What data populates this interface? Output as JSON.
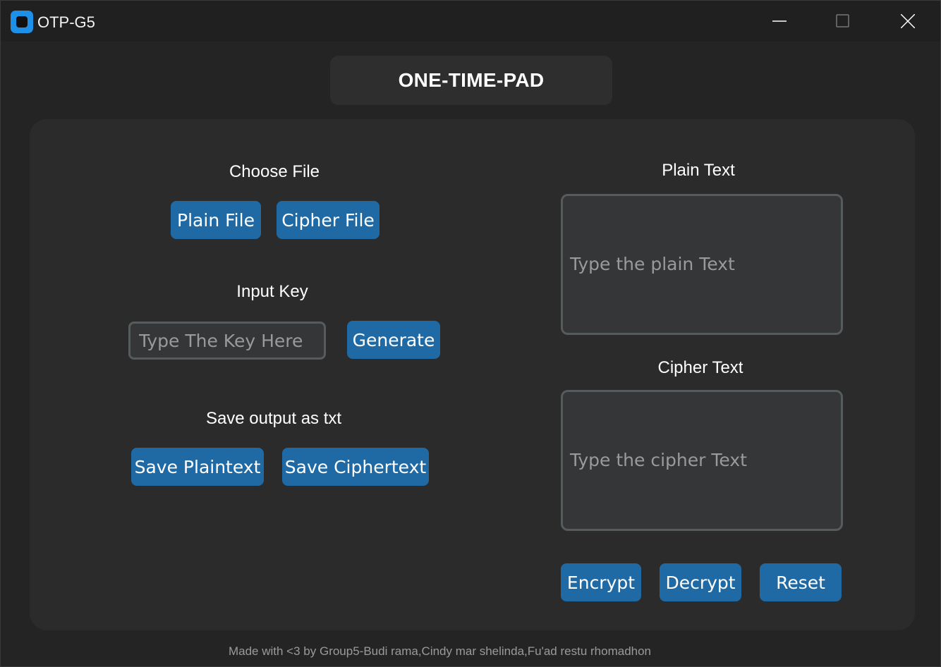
{
  "window": {
    "title": "OTP-G5"
  },
  "header": {
    "title": "ONE-TIME-PAD"
  },
  "left": {
    "choose_file_label": "Choose File",
    "plain_file_button": "Plain File",
    "cipher_file_button": "Cipher File",
    "input_key_label": "Input Key",
    "key_placeholder": "Type The Key Here",
    "key_value": "",
    "generate_button": "Generate",
    "save_output_label": "Save output as txt",
    "save_plaintext_button": "Save Plaintext",
    "save_ciphertext_button": "Save Ciphertext"
  },
  "right": {
    "plain_text_label": "Plain Text",
    "plain_text_placeholder": "Type the plain Text",
    "cipher_text_label": "Cipher Text",
    "cipher_text_placeholder": "Type the cipher Text",
    "encrypt_button": "Encrypt",
    "decrypt_button": "Decrypt",
    "reset_button": "Reset"
  },
  "footer": {
    "credits": "Made with <3 by Group5-Budi rama,Cindy mar shelinda,Fu'ad restu rhomadhon"
  },
  "colors": {
    "accent": "#1f6aa5",
    "app_icon": "#1e90e8",
    "window_bg": "#242424",
    "panel_bg": "#2b2b2b",
    "input_border": "#565b5e"
  },
  "icons": {
    "app": "app-logo-icon",
    "minimize": "minimize-icon",
    "maximize": "maximize-icon",
    "close": "close-icon"
  }
}
